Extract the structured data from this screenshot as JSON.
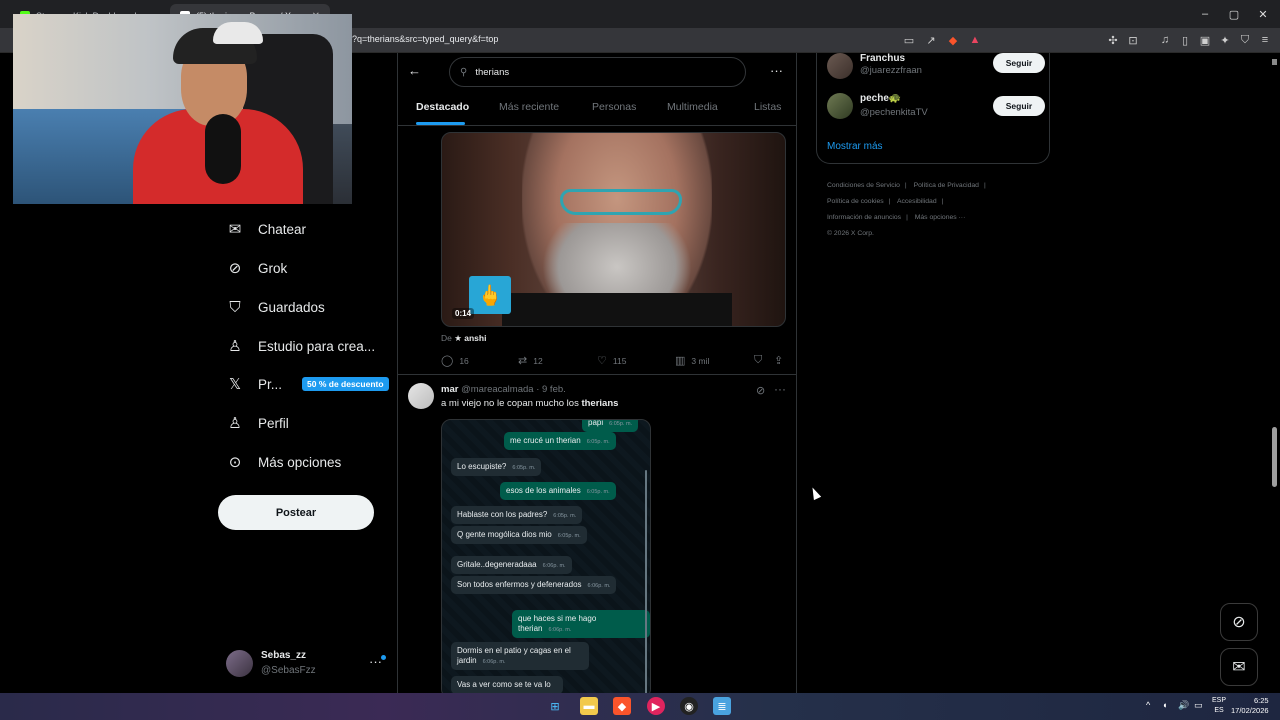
{
  "browser": {
    "tabs": [
      {
        "label": "Stream - Kick Dashboard",
        "fav_color": "#53fc18"
      },
      {
        "label": "(5) therians - Buscar / X",
        "fav_color": "#ffffff"
      }
    ],
    "url": "?q=therians&src=typed_query&f=top",
    "window_controls": [
      "–",
      "▢",
      "✕"
    ]
  },
  "nav": {
    "items": [
      {
        "label": "Chatear",
        "icon": "mail-icon"
      },
      {
        "label": "Grok",
        "icon": "grok-icon"
      },
      {
        "label": "Guardados",
        "icon": "bookmark-icon"
      },
      {
        "label": "Estudio para crea...",
        "icon": "creator-studio-icon"
      },
      {
        "label": "Pr...",
        "icon": "x-logo-icon"
      },
      {
        "label": "Perfil",
        "icon": "user-icon"
      },
      {
        "label": "Más opciones",
        "icon": "more-circle-icon"
      }
    ],
    "promo_badge": "50 % de descuento",
    "post_button": "Postear",
    "account": {
      "name": "Sebas_zz",
      "handle": "@SebasFzz"
    }
  },
  "search": {
    "query": "therians",
    "tabs": [
      "Destacado",
      "Más reciente",
      "Personas",
      "Multimedia",
      "Listas"
    ],
    "active_tab": "Destacado"
  },
  "tweet1": {
    "video_duration": "0:14",
    "from_prefix": "De",
    "from_name": "★ anshi",
    "replies": "16",
    "reposts": "12",
    "likes": "115",
    "views": "3 mil"
  },
  "tweet2": {
    "name": "mar",
    "handle": "@mareacalmada",
    "time": "· 9 feb.",
    "text_prefix": "a mi viejo no le copan mucho los",
    "text_bold": "therians",
    "chat": [
      {
        "dir": "out",
        "text": "papi",
        "time": "6:05p. m."
      },
      {
        "dir": "out",
        "text": "me crucé un therian",
        "time": "6:05p. m."
      },
      {
        "dir": "in",
        "text": "Lo escupiste?",
        "time": "6:05p. m."
      },
      {
        "dir": "out",
        "text": "esos de los animales",
        "time": "6:05p. m."
      },
      {
        "dir": "in",
        "text": "Hablaste con los padres?",
        "time": "6:05p. m."
      },
      {
        "dir": "in",
        "text": "Q gente mogólica dios mio",
        "time": "6:05p. m."
      },
      {
        "dir": "in",
        "text": "Gritale..degeneradaaa",
        "time": "6:06p. m."
      },
      {
        "dir": "in",
        "text": "Son todos enfermos y defenerados",
        "time": "6:06p. m."
      },
      {
        "dir": "out",
        "text": "que haces si me hago therian",
        "time": "6:06p. m."
      },
      {
        "dir": "in",
        "text": "Dormis en el patio y cagas en el jardin",
        "time": "6:06p. m."
      },
      {
        "dir": "in",
        "text": "Vas a ver como se te va lo",
        "time": ""
      }
    ]
  },
  "who_to_follow": {
    "items": [
      {
        "name": "Franchus",
        "handle": "@juarezzfraan",
        "button": "Seguir"
      },
      {
        "name": "peche🐢",
        "handle": "@pechenkitaTV",
        "button": "Seguir"
      }
    ],
    "show_more": "Mostrar más"
  },
  "footer": {
    "links": [
      "Condiciones de Servicio",
      "Política de Privacidad",
      "Política de cookies",
      "Accesibilidad",
      "Información de anuncios",
      "Más opciones ···"
    ],
    "copyright": "© 2026 X Corp."
  },
  "taskbar": {
    "lang_top": "ESP",
    "lang_bottom": "ES",
    "time": "6:25",
    "date": "17/02/2026"
  },
  "colors": {
    "accent": "#1d9bf0",
    "background": "#000000",
    "muted_text": "#71767b",
    "border": "#2f3336"
  }
}
